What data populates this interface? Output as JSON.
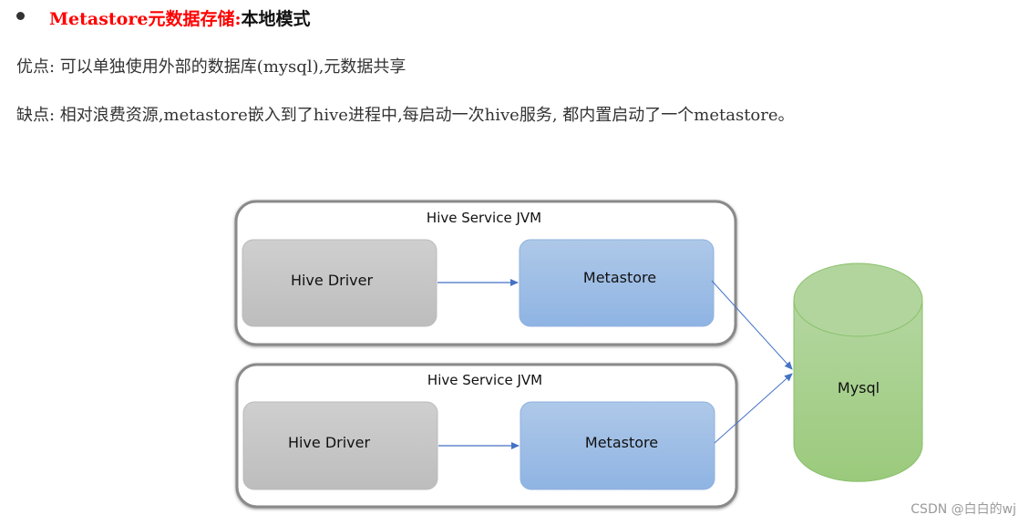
{
  "heading": {
    "highlight": "Metastore元数据存储:",
    "rest": "本地模式",
    "highlight_color": "#ff0000"
  },
  "pros": {
    "label": "优点: ",
    "text": "可以单独使用外部的数据库(mysql),元数据共享"
  },
  "cons": {
    "label": "缺点: ",
    "text": "相对浪费资源,metastore嵌入到了hive进程中,每启动一次hive服务, 都内置启动了一个metastore。"
  },
  "diagram": {
    "jvms": [
      {
        "title": "Hive Service JVM",
        "driver": "Hive Driver",
        "metastore": "Metastore"
      },
      {
        "title": "Hive Service JVM",
        "driver": "Hive Driver",
        "metastore": "Metastore"
      }
    ],
    "database": "Mysql",
    "colors": {
      "driver": "#c9c9c9",
      "metastore": "#9dbde6",
      "database": "#a9d18e",
      "arrow": "#4472c4"
    }
  },
  "watermark": "CSDN @白白的wj"
}
